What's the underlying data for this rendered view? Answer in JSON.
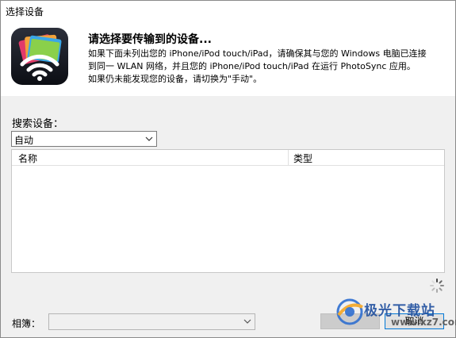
{
  "window": {
    "title": "选择设备"
  },
  "header": {
    "app_icon": "photosync-wifi-icon",
    "title": "请选择要传输到的设备...",
    "desc_lines": [
      "如果下面未列出您的 iPhone/iPod touch/iPad，请确保其与您的 Windows 电脑已连接",
      "到同一 WLAN 网络，并且您的 iPhone/iPod touch/iPad 在运行 PhotoSync 应用。",
      "如果仍未能发现您的设备，请切换为\"手动\"。"
    ]
  },
  "search": {
    "label": "搜索设备：",
    "selected": "自动"
  },
  "device_table": {
    "columns": [
      "名称",
      "类型"
    ],
    "rows": []
  },
  "album": {
    "label": "相簿：",
    "selected": ""
  },
  "buttons": {
    "ok_label": "",
    "cancel_label": "取消"
  },
  "watermark": {
    "text": "极光下载站",
    "url": "www.xz7.com"
  }
}
